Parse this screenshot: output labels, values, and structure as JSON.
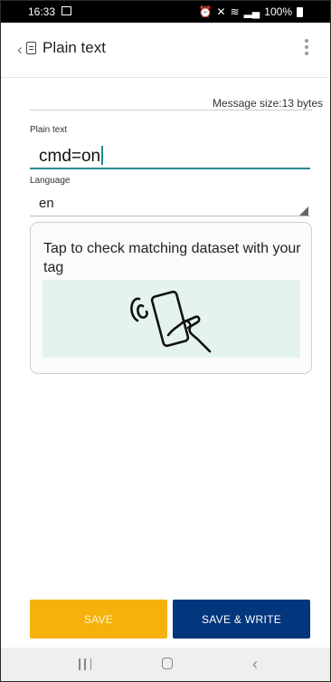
{
  "status_bar": {
    "time": "16:33",
    "battery": "100%"
  },
  "app_bar": {
    "back": "‹",
    "title": "Plain text"
  },
  "message_size": "Message size:13 bytes",
  "form": {
    "plain_text_label": "Plain text",
    "plain_text_value": "cmd=on",
    "language_label": "Language",
    "language_value": "en"
  },
  "card": {
    "text": "Tap to check matching dataset with your tag"
  },
  "buttons": {
    "save": "SAVE",
    "save_write": "SAVE & WRITE"
  },
  "nav": {
    "back": "‹"
  },
  "colors": {
    "save": "#f5b20a",
    "save_write": "#02367d",
    "accent": "#2a8a95",
    "illustration_bg": "#e4f3ee"
  }
}
